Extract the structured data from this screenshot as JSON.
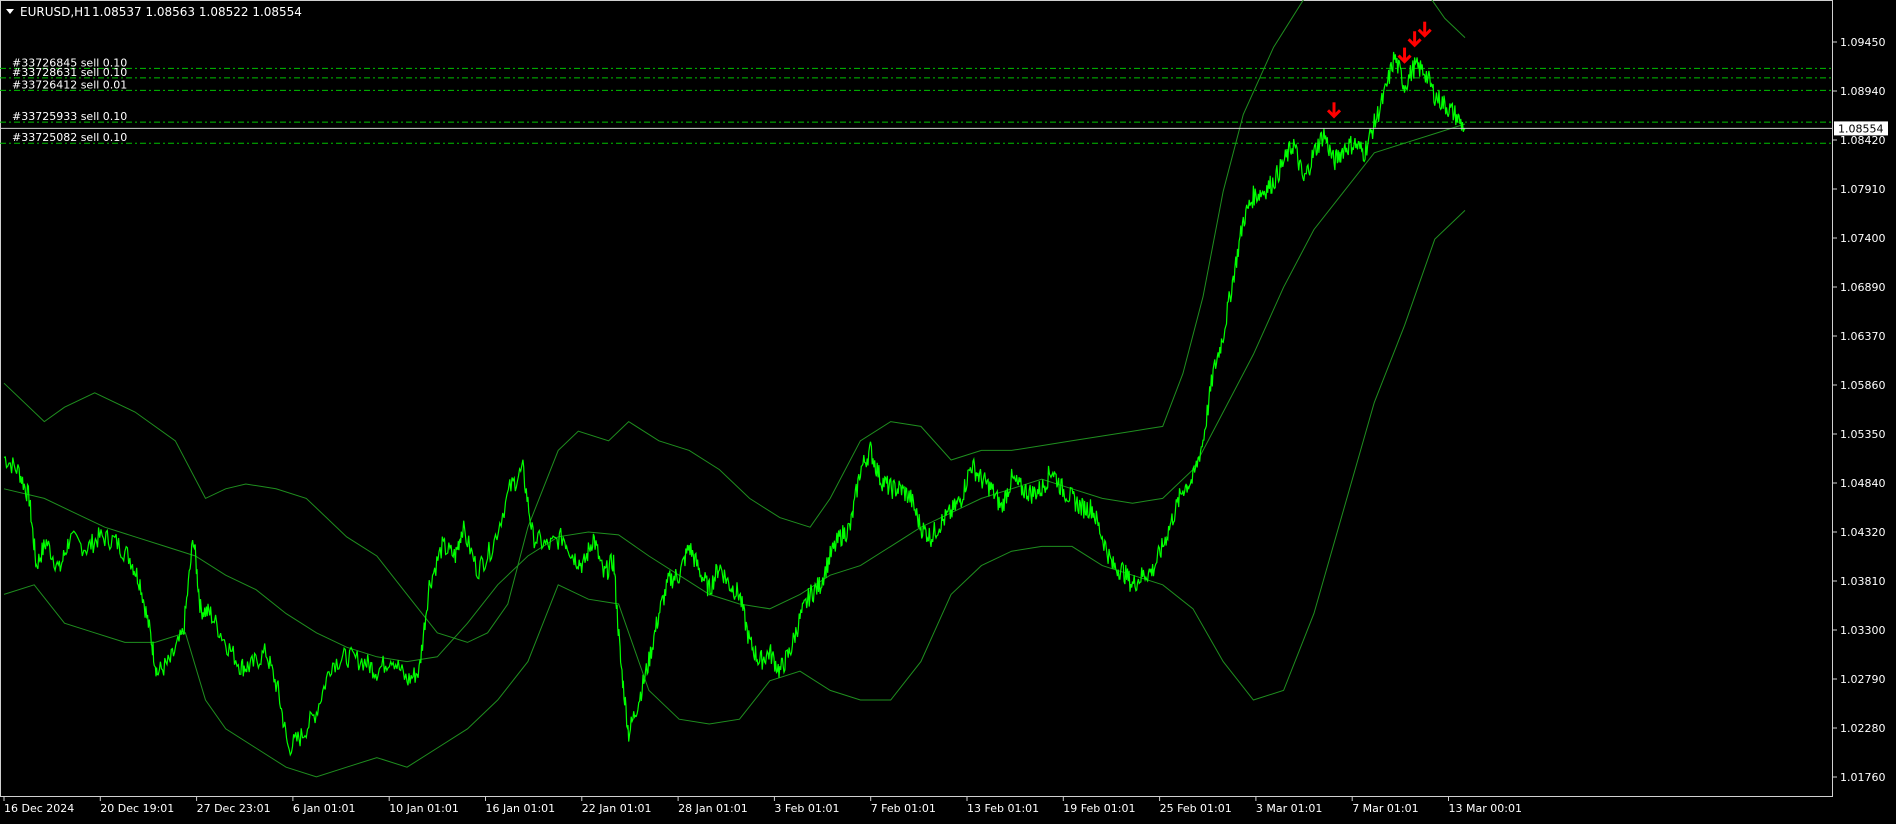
{
  "header": {
    "symbol_label": "EURUSD,H1",
    "ohlc": "1.08537 1.08563 1.08522 1.08554",
    "menu_icon": "triangle-down-icon"
  },
  "colors": {
    "background": "#000000",
    "price": "#00ff00",
    "bands": "#1f8f1f",
    "orders": "#00c000",
    "sell_arrow": "#ff0000",
    "grid_text": "#ffffff"
  },
  "current_price": "1.08554",
  "price_axis_labels": [
    "1.09450",
    "1.08940",
    "1.08420",
    "1.07910",
    "1.07400",
    "1.06890",
    "1.06370",
    "1.05860",
    "1.05350",
    "1.04840",
    "1.04320",
    "1.03810",
    "1.03300",
    "1.02790",
    "1.02280",
    "1.01760"
  ],
  "time_axis_labels": [
    "16 Dec 2024",
    "20 Dec 19:01",
    "27 Dec 23:01",
    "6 Jan 01:01",
    "10 Jan 01:01",
    "16 Jan 01:01",
    "22 Jan 01:01",
    "28 Jan 01:01",
    "3 Feb 01:01",
    "7 Feb 01:01",
    "13 Feb 01:01",
    "19 Feb 01:01",
    "25 Feb 01:01",
    "3 Mar 01:01",
    "7 Mar 01:01",
    "13 Mar 00:01"
  ],
  "orders": [
    {
      "label": "#33726845 sell 0.10",
      "price": 1.0918
    },
    {
      "label": "#33728631 sell 0.10",
      "price": 1.0908
    },
    {
      "label": "#33726412 sell 0.01",
      "price": 1.0895
    },
    {
      "label": "#33725933 sell 0.10",
      "price": 1.0862
    },
    {
      "label": "#33725082 sell 0.10",
      "price": 1.084
    }
  ],
  "chart_data": {
    "type": "line",
    "symbol": "EURUSD",
    "timeframe": "H1",
    "ylim": [
      1.016,
      1.0985
    ],
    "close_series": [
      [
        0,
        1.0513
      ],
      [
        1.5,
        1.0498
      ],
      [
        2.5,
        1.047
      ],
      [
        3.2,
        1.04
      ],
      [
        4.2,
        1.0425
      ],
      [
        5.5,
        1.0395
      ],
      [
        6.5,
        1.0428
      ],
      [
        8.2,
        1.0418
      ],
      [
        9.5,
        1.043
      ],
      [
        11,
        1.0426
      ],
      [
        12.5,
        1.0408
      ],
      [
        13.5,
        1.0383
      ],
      [
        14.5,
        1.033
      ],
      [
        15.2,
        1.0288
      ],
      [
        16.5,
        1.03
      ],
      [
        17.8,
        1.033
      ],
      [
        18.8,
        1.043
      ],
      [
        19.5,
        1.0355
      ],
      [
        20.5,
        1.035
      ],
      [
        22,
        1.032
      ],
      [
        23.5,
        1.0295
      ],
      [
        24.5,
        1.0295
      ],
      [
        26,
        1.031
      ],
      [
        27.2,
        1.027
      ],
      [
        28.2,
        1.021
      ],
      [
        29.5,
        1.0222
      ],
      [
        31,
        1.0248
      ],
      [
        32.5,
        1.0298
      ],
      [
        34,
        1.0305
      ],
      [
        35.8,
        1.03
      ],
      [
        37,
        1.029
      ],
      [
        38.5,
        1.0305
      ],
      [
        40,
        1.028
      ],
      [
        41.2,
        1.029
      ],
      [
        42.2,
        1.038
      ],
      [
        43.5,
        1.042
      ],
      [
        44.8,
        1.041
      ],
      [
        45.5,
        1.044
      ],
      [
        47,
        1.0395
      ],
      [
        48.5,
        1.042
      ],
      [
        50.2,
        1.048
      ],
      [
        51.5,
        1.05
      ],
      [
        52.5,
        1.043
      ],
      [
        54,
        1.042
      ],
      [
        55.5,
        1.043
      ],
      [
        56.5,
        1.041
      ],
      [
        57.5,
        1.04
      ],
      [
        58.5,
        1.043
      ],
      [
        59.5,
        1.039
      ],
      [
        60.5,
        1.0405
      ],
      [
        61.2,
        1.03
      ],
      [
        62,
        1.0225
      ],
      [
        63,
        1.026
      ],
      [
        64,
        1.03
      ],
      [
        65,
        1.035
      ],
      [
        66,
        1.0385
      ],
      [
        67,
        1.039
      ],
      [
        68,
        1.042
      ],
      [
        69,
        1.0395
      ],
      [
        70,
        1.0375
      ],
      [
        71,
        1.04
      ],
      [
        72,
        1.038
      ],
      [
        73,
        1.037
      ],
      [
        74,
        1.032
      ],
      [
        75,
        1.03
      ],
      [
        76,
        1.031
      ],
      [
        77,
        1.029
      ],
      [
        78,
        1.031
      ],
      [
        79,
        1.0345
      ],
      [
        80,
        1.037
      ],
      [
        81,
        1.038
      ],
      [
        82,
        1.041
      ],
      [
        83,
        1.043
      ],
      [
        84,
        1.044
      ],
      [
        85,
        1.05
      ],
      [
        86,
        1.052
      ],
      [
        87,
        1.049
      ],
      [
        88,
        1.048
      ],
      [
        89,
        1.048
      ],
      [
        90,
        1.047
      ],
      [
        91,
        1.044
      ],
      [
        92,
        1.043
      ],
      [
        93,
        1.0445
      ],
      [
        94,
        1.0455
      ],
      [
        95,
        1.047
      ],
      [
        96,
        1.0505
      ],
      [
        97,
        1.049
      ],
      [
        98,
        1.048
      ],
      [
        99,
        1.046
      ],
      [
        100,
        1.049
      ],
      [
        101,
        1.048
      ],
      [
        102,
        1.0475
      ],
      [
        103,
        1.048
      ],
      [
        104,
        1.05
      ],
      [
        105,
        1.048
      ],
      [
        106,
        1.047
      ],
      [
        107,
        1.046
      ],
      [
        108,
        1.046
      ],
      [
        109,
        1.043
      ],
      [
        110,
        1.04
      ],
      [
        111,
        1.0395
      ],
      [
        112,
        1.038
      ],
      [
        113,
        1.039
      ],
      [
        114,
        1.0395
      ],
      [
        115,
        1.042
      ],
      [
        116,
        1.045
      ],
      [
        117,
        1.048
      ],
      [
        118,
        1.049
      ],
      [
        119,
        1.053
      ],
      [
        120,
        1.06
      ],
      [
        121,
        1.064
      ],
      [
        122,
        1.07
      ],
      [
        123,
        1.076
      ],
      [
        124,
        1.0785
      ],
      [
        125,
        1.079
      ],
      [
        126,
        1.08
      ],
      [
        127,
        1.082
      ],
      [
        128,
        1.084
      ],
      [
        129,
        1.08
      ],
      [
        130,
        1.083
      ],
      [
        131,
        1.085
      ],
      [
        132,
        1.082
      ],
      [
        133,
        1.0835
      ],
      [
        134,
        1.084
      ],
      [
        135,
        1.083
      ],
      [
        136,
        1.086
      ],
      [
        137,
        1.089
      ],
      [
        138,
        1.093
      ],
      [
        139,
        1.09
      ],
      [
        140,
        1.092
      ],
      [
        141,
        1.0915
      ],
      [
        142,
        1.089
      ],
      [
        143,
        1.088
      ],
      [
        144,
        1.087
      ],
      [
        145,
        1.0855
      ]
    ],
    "bb_upper": [
      [
        0,
        1.059
      ],
      [
        4,
        1.055
      ],
      [
        6,
        1.0565
      ],
      [
        9,
        1.058
      ],
      [
        13,
        1.056
      ],
      [
        17,
        1.053
      ],
      [
        20,
        1.047
      ],
      [
        22,
        1.048
      ],
      [
        24,
        1.0485
      ],
      [
        27,
        1.048
      ],
      [
        30,
        1.047
      ],
      [
        34,
        1.043
      ],
      [
        37,
        1.041
      ],
      [
        40,
        1.037
      ],
      [
        43,
        1.033
      ],
      [
        46,
        1.032
      ],
      [
        48,
        1.033
      ],
      [
        50,
        1.036
      ],
      [
        52,
        1.044
      ],
      [
        55,
        1.052
      ],
      [
        57,
        1.054
      ],
      [
        60,
        1.053
      ],
      [
        62,
        1.055
      ],
      [
        65,
        1.053
      ],
      [
        68,
        1.052
      ],
      [
        71,
        1.05
      ],
      [
        74,
        1.047
      ],
      [
        77,
        1.045
      ],
      [
        80,
        1.044
      ],
      [
        82,
        1.047
      ],
      [
        85,
        1.053
      ],
      [
        88,
        1.055
      ],
      [
        91,
        1.0545
      ],
      [
        94,
        1.051
      ],
      [
        97,
        1.052
      ],
      [
        100,
        1.052
      ],
      [
        103,
        1.0525
      ],
      [
        106,
        1.053
      ],
      [
        109,
        1.0535
      ],
      [
        112,
        1.054
      ],
      [
        115,
        1.0545
      ],
      [
        117,
        1.06
      ],
      [
        119,
        1.068
      ],
      [
        121,
        1.079
      ],
      [
        123,
        1.087
      ],
      [
        126,
        1.094
      ],
      [
        129,
        1.099
      ],
      [
        132,
        1.102
      ],
      [
        135,
        1.104
      ],
      [
        138,
        1.103
      ],
      [
        141,
        1.1
      ],
      [
        143,
        1.097
      ],
      [
        145,
        1.095
      ]
    ],
    "bb_middle": [
      [
        0,
        1.048
      ],
      [
        4,
        1.047
      ],
      [
        7,
        1.0455
      ],
      [
        10,
        1.044
      ],
      [
        13,
        1.043
      ],
      [
        16,
        1.042
      ],
      [
        19,
        1.041
      ],
      [
        22,
        1.039
      ],
      [
        25,
        1.0375
      ],
      [
        28,
        1.035
      ],
      [
        31,
        1.033
      ],
      [
        34,
        1.0315
      ],
      [
        37,
        1.0305
      ],
      [
        40,
        1.03
      ],
      [
        43,
        1.0305
      ],
      [
        46,
        1.034
      ],
      [
        49,
        1.038
      ],
      [
        52,
        1.041
      ],
      [
        55,
        1.043
      ],
      [
        58,
        1.0435
      ],
      [
        61,
        1.0432
      ],
      [
        64,
        1.041
      ],
      [
        67,
        1.039
      ],
      [
        70,
        1.037
      ],
      [
        73,
        1.036
      ],
      [
        76,
        1.0355
      ],
      [
        79,
        1.037
      ],
      [
        82,
        1.039
      ],
      [
        85,
        1.04
      ],
      [
        88,
        1.042
      ],
      [
        91,
        1.044
      ],
      [
        94,
        1.0455
      ],
      [
        97,
        1.047
      ],
      [
        100,
        1.048
      ],
      [
        103,
        1.049
      ],
      [
        106,
        1.048
      ],
      [
        109,
        1.047
      ],
      [
        112,
        1.0465
      ],
      [
        115,
        1.047
      ],
      [
        118,
        1.05
      ],
      [
        121,
        1.056
      ],
      [
        124,
        1.062
      ],
      [
        127,
        1.069
      ],
      [
        130,
        1.075
      ],
      [
        133,
        1.079
      ],
      [
        136,
        1.083
      ],
      [
        139,
        1.084
      ],
      [
        142,
        1.085
      ],
      [
        145,
        1.086
      ]
    ],
    "bb_lower": [
      [
        0,
        1.037
      ],
      [
        3,
        1.038
      ],
      [
        6,
        1.034
      ],
      [
        9,
        1.033
      ],
      [
        12,
        1.032
      ],
      [
        15,
        1.032
      ],
      [
        18,
        1.033
      ],
      [
        20,
        1.026
      ],
      [
        22,
        1.023
      ],
      [
        25,
        1.021
      ],
      [
        28,
        1.019
      ],
      [
        31,
        1.018
      ],
      [
        34,
        1.019
      ],
      [
        37,
        1.02
      ],
      [
        40,
        1.019
      ],
      [
        43,
        1.021
      ],
      [
        46,
        1.023
      ],
      [
        49,
        1.026
      ],
      [
        52,
        1.03
      ],
      [
        55,
        1.038
      ],
      [
        58,
        1.0365
      ],
      [
        61,
        1.036
      ],
      [
        64,
        1.027
      ],
      [
        67,
        1.024
      ],
      [
        70,
        1.0235
      ],
      [
        73,
        1.024
      ],
      [
        76,
        1.028
      ],
      [
        79,
        1.029
      ],
      [
        82,
        1.027
      ],
      [
        85,
        1.026
      ],
      [
        88,
        1.026
      ],
      [
        91,
        1.03
      ],
      [
        94,
        1.037
      ],
      [
        97,
        1.04
      ],
      [
        100,
        1.0415
      ],
      [
        103,
        1.042
      ],
      [
        106,
        1.042
      ],
      [
        109,
        1.04
      ],
      [
        112,
        1.039
      ],
      [
        115,
        1.038
      ],
      [
        118,
        1.0355
      ],
      [
        121,
        1.03
      ],
      [
        124,
        1.026
      ],
      [
        127,
        1.027
      ],
      [
        130,
        1.035
      ],
      [
        133,
        1.046
      ],
      [
        136,
        1.057
      ],
      [
        139,
        1.065
      ],
      [
        142,
        1.074
      ],
      [
        145,
        1.077
      ]
    ],
    "sell_arrows": [
      {
        "t": 132,
        "price": 1.0868
      },
      {
        "t": 139,
        "price": 1.0925
      },
      {
        "t": 140,
        "price": 1.0942
      },
      {
        "t": 141,
        "price": 1.0952
      }
    ]
  }
}
